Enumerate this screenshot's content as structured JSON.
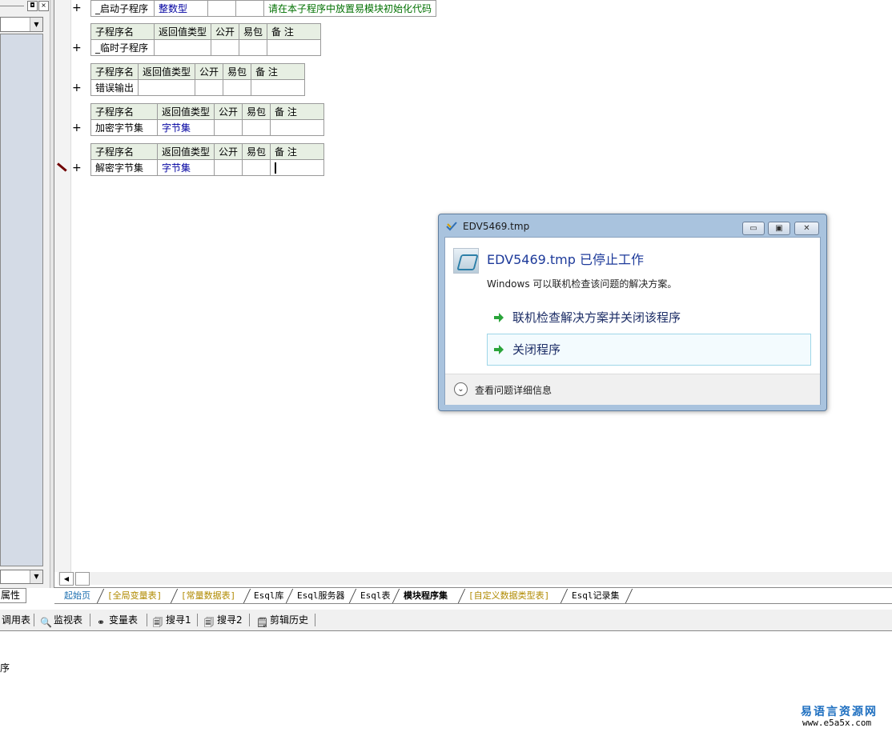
{
  "left_panel": {
    "tab_label": "属性",
    "pin_glyph": "◘",
    "close_glyph": "×",
    "dropdown_glyph": "▼"
  },
  "editor": {
    "expand_glyph": "+",
    "header": {
      "name": "子程序名",
      "return_type": "返回值类型",
      "public": "公开",
      "easy_pack": "易包",
      "note": "备 注"
    },
    "subroutines": [
      {
        "name": "_启动子程序",
        "return_type": "整数型",
        "note": "请在本子程序中放置易模块初始化代码"
      },
      {
        "name": "_临时子程序",
        "return_type": "",
        "note": ""
      },
      {
        "name": "错误输出",
        "return_type": "",
        "note": ""
      },
      {
        "name": "加密字节集",
        "return_type": "字节集",
        "note": ""
      },
      {
        "name": "解密字节集",
        "return_type": "字节集",
        "note": ""
      }
    ],
    "scroll_left_glyph": "◀"
  },
  "bottom_tabs": [
    {
      "label": "起始页"
    },
    {
      "label": "[全局变量表]"
    },
    {
      "label": "[常量数据表]"
    },
    {
      "label": "Esql库"
    },
    {
      "label": "Esql服务器"
    },
    {
      "label": "Esql表"
    },
    {
      "label": "模块程序集"
    },
    {
      "label": "[自定义数据类型表]"
    },
    {
      "label": "Esql记录集"
    }
  ],
  "toolbar": {
    "items": [
      {
        "label": "调用表",
        "icon": ""
      },
      {
        "label": "监视表",
        "icon": "🔍"
      },
      {
        "label": "变量表",
        "icon": "⚭"
      },
      {
        "label": "搜寻1",
        "icon": "🗐"
      },
      {
        "label": "搜寻2",
        "icon": "🗐"
      },
      {
        "label": "剪辑历史",
        "icon": "🗒"
      }
    ]
  },
  "output": {
    "text": "序"
  },
  "watermark": {
    "brand": "易语言资源网",
    "url": "www.e5a5x.com"
  },
  "dialog": {
    "title": "EDV5469.tmp",
    "heading": "EDV5469.tmp 已停止工作",
    "description": "Windows 可以联机检查该问题的解决方案。",
    "option_check": "联机检查解决方案并关闭该程序",
    "option_close": "关闭程序",
    "details": "查看问题详细信息",
    "minimize_glyph": "▭",
    "maximize_glyph": "▣",
    "close_glyph": "✕",
    "details_glyph": "⌄"
  },
  "colors": {
    "table_header": "#e7efe3",
    "type_text": "#0000a0",
    "note_text": "#007000",
    "dialog_heading": "#1d3a9a",
    "green_arrow": "#2aa43a"
  }
}
